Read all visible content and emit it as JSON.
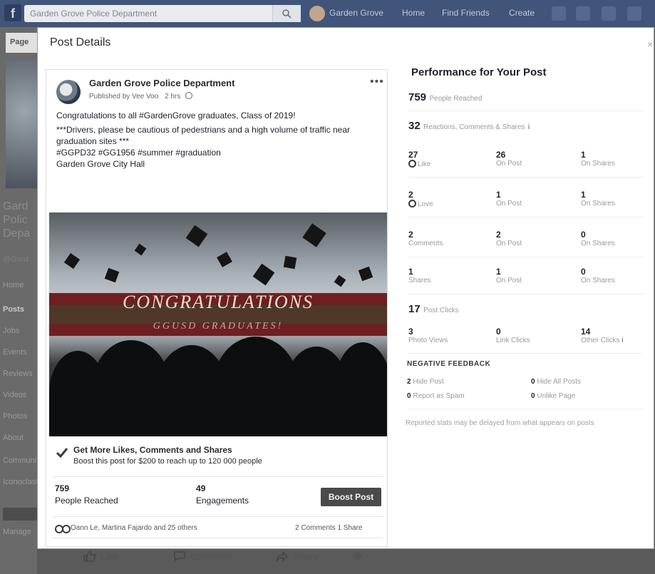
{
  "topbar": {
    "search_placeholder": "Garden Grove Police Department",
    "profile_name": "Garden Grove",
    "nav": [
      "Home",
      "Find Friends",
      "Create"
    ]
  },
  "left_sidebar": {
    "page_tab": "Page",
    "page_name": [
      "Gard",
      "Polic",
      "Depa"
    ],
    "handle": "@Gard",
    "items": [
      "Home",
      "Posts",
      "Jobs",
      "Events",
      "Reviews",
      "Videos",
      "Photos",
      "About",
      "Community",
      "Iconoclast"
    ],
    "manage": "Manage"
  },
  "modal": {
    "title": "Post Details",
    "close": "×"
  },
  "post": {
    "page_name": "Garden Grove Police Department",
    "published_by": "Published by Vee Voo",
    "time": "2 hrs",
    "more": "•••",
    "text": [
      "Congratulations to all #GardenGrove graduates, Class of 2019!",
      "***Drivers, please be cautious of pedestrians and a high volume of traffic near graduation sites ***",
      "#GGPD32 #GG1956 #summer #graduation",
      "Garden Grove City Hall"
    ],
    "image": {
      "headline": "CONGRATULATIONS",
      "subline": "GGUSD GRADUATES!"
    },
    "boost": {
      "title": "Get More Likes, Comments and Shares",
      "subtitle": "Boost this post for $200 to reach up to 120 000 people"
    },
    "stats": {
      "reach_value": "759",
      "reach_label": "People Reached",
      "engagement_value": "49",
      "engagement_label": "Engagements"
    },
    "boost_button": "Boost Post",
    "reactions_text": "Oann Le, Martina Fajardo and 25 others",
    "comments_shares": "2 Comments  1 Share",
    "actions": {
      "like": "Like",
      "comment": "Comment",
      "share": "Share"
    }
  },
  "performance": {
    "title": "Performance for Your Post",
    "people_reached_value": "759",
    "people_reached_label": "People Reached",
    "reactions_value": "32",
    "reactions_label": "Reactions, Comments & Shares",
    "info": "i",
    "grid": [
      {
        "total": "27",
        "type": "Like",
        "on_post": "26",
        "on_post_label": "On Post",
        "on_shares": "1",
        "on_shares_label": "On Shares"
      },
      {
        "total": "2",
        "type": "Love",
        "on_post": "1",
        "on_post_label": "On Post",
        "on_shares": "1",
        "on_shares_label": "On Shares"
      },
      {
        "total": "2",
        "type": "Comments",
        "on_post": "2",
        "on_post_label": "On Post",
        "on_shares": "0",
        "on_shares_label": "On Shares"
      },
      {
        "total": "1",
        "type": "Shares",
        "on_post": "1",
        "on_post_label": "On Post",
        "on_shares": "0",
        "on_shares_label": "On Shares"
      }
    ],
    "post_clicks_value": "17",
    "post_clicks_label": "Post Clicks",
    "clicks": [
      {
        "value": "3",
        "label": "Photo Views"
      },
      {
        "value": "0",
        "label": "Link Clicks"
      },
      {
        "value": "14",
        "label": "Other Clicks"
      }
    ],
    "negative_title": "NEGATIVE FEEDBACK",
    "negative": [
      {
        "value": "2",
        "label": "Hide Post"
      },
      {
        "value": "0",
        "label": "Hide All Posts"
      },
      {
        "value": "0",
        "label": "Report as Spam"
      },
      {
        "value": "0",
        "label": "Unlike Page"
      }
    ],
    "note": "Reported stats may be delayed from what appears on posts"
  }
}
